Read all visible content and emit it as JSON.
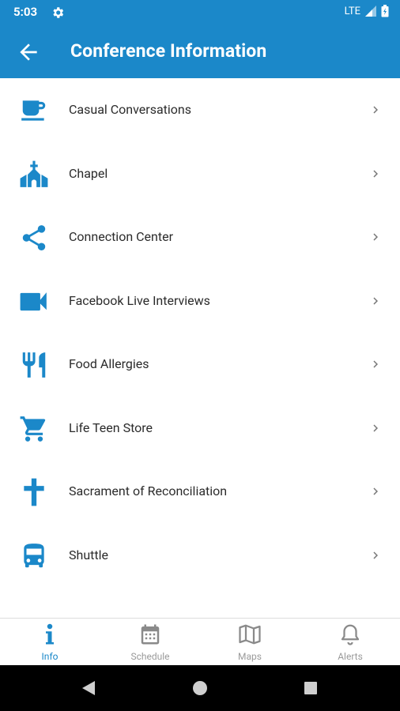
{
  "status": {
    "time": "5:03",
    "network": "LTE"
  },
  "header": {
    "title": "Conference Information"
  },
  "items": [
    {
      "label": "Casual Conversations",
      "icon": "coffee-cup-icon"
    },
    {
      "label": "Chapel",
      "icon": "church-icon"
    },
    {
      "label": "Connection Center",
      "icon": "share-icon"
    },
    {
      "label": "Facebook Live Interviews",
      "icon": "video-camera-icon"
    },
    {
      "label": "Food Allergies",
      "icon": "fork-knife-icon"
    },
    {
      "label": "Life Teen Store",
      "icon": "shopping-cart-icon"
    },
    {
      "label": "Sacrament of Reconciliation",
      "icon": "cross-icon"
    },
    {
      "label": "Shuttle",
      "icon": "bus-icon"
    }
  ],
  "bottom_nav": [
    {
      "label": "Info",
      "icon": "info-icon",
      "active": true
    },
    {
      "label": "Schedule",
      "icon": "calendar-icon",
      "active": false
    },
    {
      "label": "Maps",
      "icon": "map-icon",
      "active": false
    },
    {
      "label": "Alerts",
      "icon": "bell-icon",
      "active": false
    }
  ],
  "colors": {
    "primary": "#1b88c9",
    "text": "#2b2b2b",
    "inactive": "#9a9a9a"
  }
}
